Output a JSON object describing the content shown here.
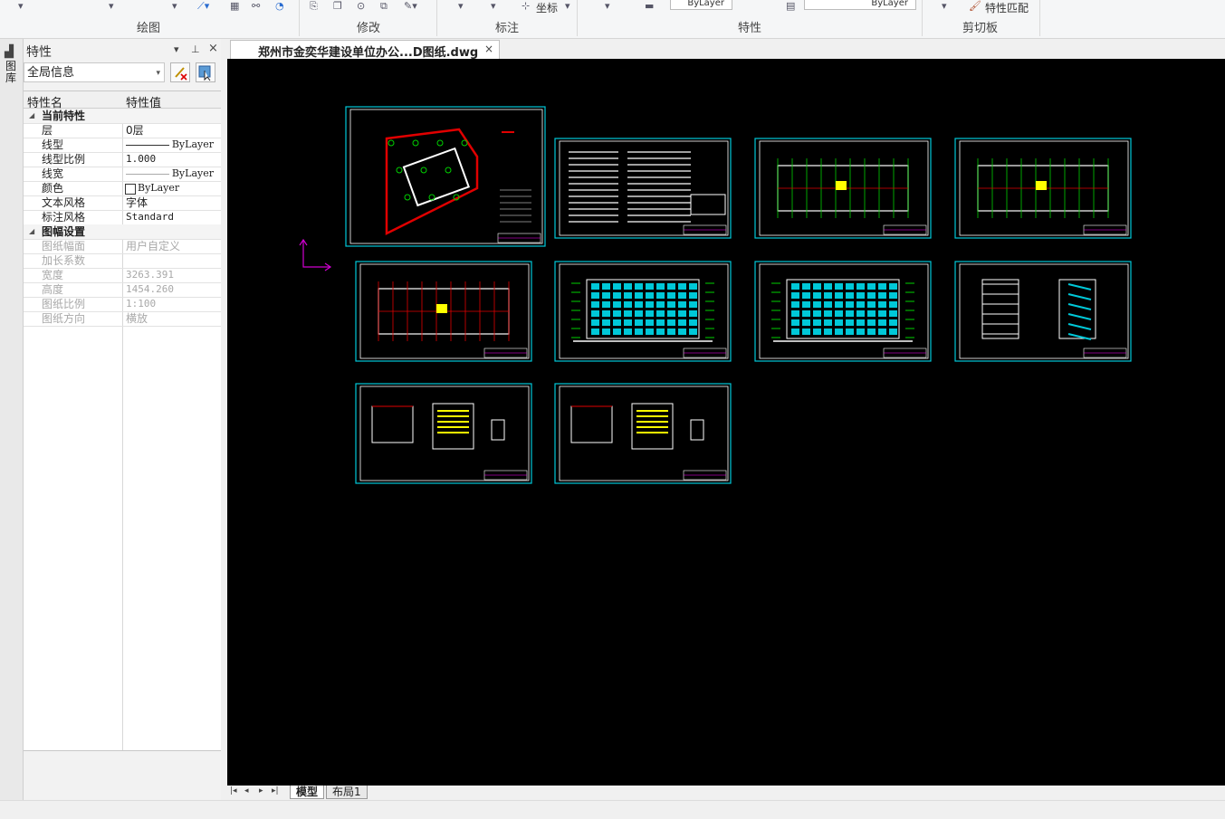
{
  "ribbon": {
    "groups": [
      {
        "label": "绘图"
      },
      {
        "label": "修改"
      },
      {
        "label": "标注"
      },
      {
        "label": "特性"
      },
      {
        "label": "剪切板"
      }
    ],
    "coord_label": "坐标",
    "layer_combo_value": "ByLayer",
    "linetype_combo_value": "ByLayer",
    "match_props_label": "特性匹配"
  },
  "left_strip": {
    "label": "图库"
  },
  "properties_panel": {
    "title": "特性",
    "selection": "全局信息",
    "header": {
      "name": "特性名",
      "value": "特性值"
    },
    "categories": [
      {
        "label": "当前特性",
        "rows": [
          {
            "name": "层",
            "value": "0层"
          },
          {
            "name": "线型",
            "value": "ByLayer"
          },
          {
            "name": "线型比例",
            "value": "1.000"
          },
          {
            "name": "线宽",
            "value": "ByLayer"
          },
          {
            "name": "颜色",
            "value": "ByLayer"
          },
          {
            "name": "文本风格",
            "value": "字体"
          },
          {
            "name": "标注风格",
            "value": "Standard"
          }
        ]
      },
      {
        "label": "图幅设置",
        "rows": [
          {
            "name": "图纸幅面",
            "value": "用户自定义"
          },
          {
            "name": "加长系数",
            "value": ""
          },
          {
            "name": "宽度",
            "value": "3263.391"
          },
          {
            "name": "高度",
            "value": "1454.260"
          },
          {
            "name": "图纸比例",
            "value": "1:100"
          },
          {
            "name": "图纸方向",
            "value": "横放"
          }
        ]
      }
    ]
  },
  "document_tab": {
    "title": "郑州市金奕华建设单位办公...D图纸.dwg"
  },
  "layout_tabs": [
    {
      "label": "模型",
      "active": true
    },
    {
      "label": "布局1",
      "active": false
    }
  ],
  "colors": {
    "canvas_bg": "#000000",
    "frame": "#00c8d8",
    "accent_red": "#e00000",
    "accent_green": "#00d000",
    "accent_yellow": "#ffff00",
    "ucs": "#d000d0"
  }
}
